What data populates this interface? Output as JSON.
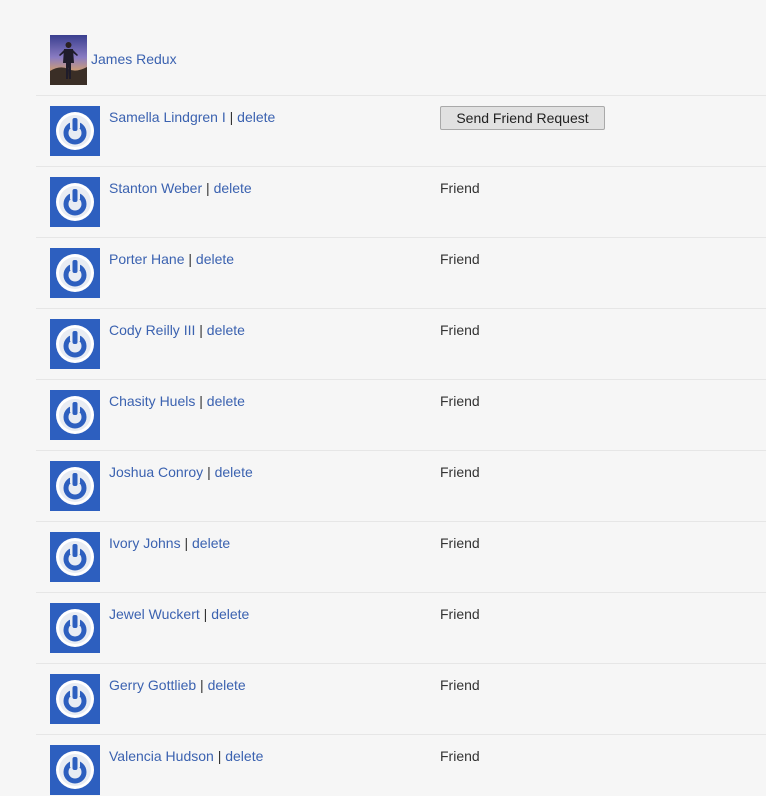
{
  "current_user": {
    "name": "James Redux"
  },
  "delete_label": "delete",
  "separator": "|",
  "users": [
    {
      "name": "Samella Lindgren I",
      "action": "Send Friend Request"
    },
    {
      "name": "Stanton Weber",
      "status": "Friend"
    },
    {
      "name": "Porter Hane",
      "status": "Friend"
    },
    {
      "name": "Cody Reilly III",
      "status": "Friend"
    },
    {
      "name": "Chasity Huels",
      "status": "Friend"
    },
    {
      "name": "Joshua Conroy",
      "status": "Friend"
    },
    {
      "name": "Ivory Johns",
      "status": "Friend"
    },
    {
      "name": "Jewel Wuckert",
      "status": "Friend"
    },
    {
      "name": "Gerry Gottlieb",
      "status": "Friend"
    },
    {
      "name": "Valencia Hudson",
      "status": "Friend"
    }
  ],
  "icons": {
    "default_avatar": "power-icon",
    "avatar_color": "#2d5fbf",
    "link_color": "#3b62b0"
  }
}
